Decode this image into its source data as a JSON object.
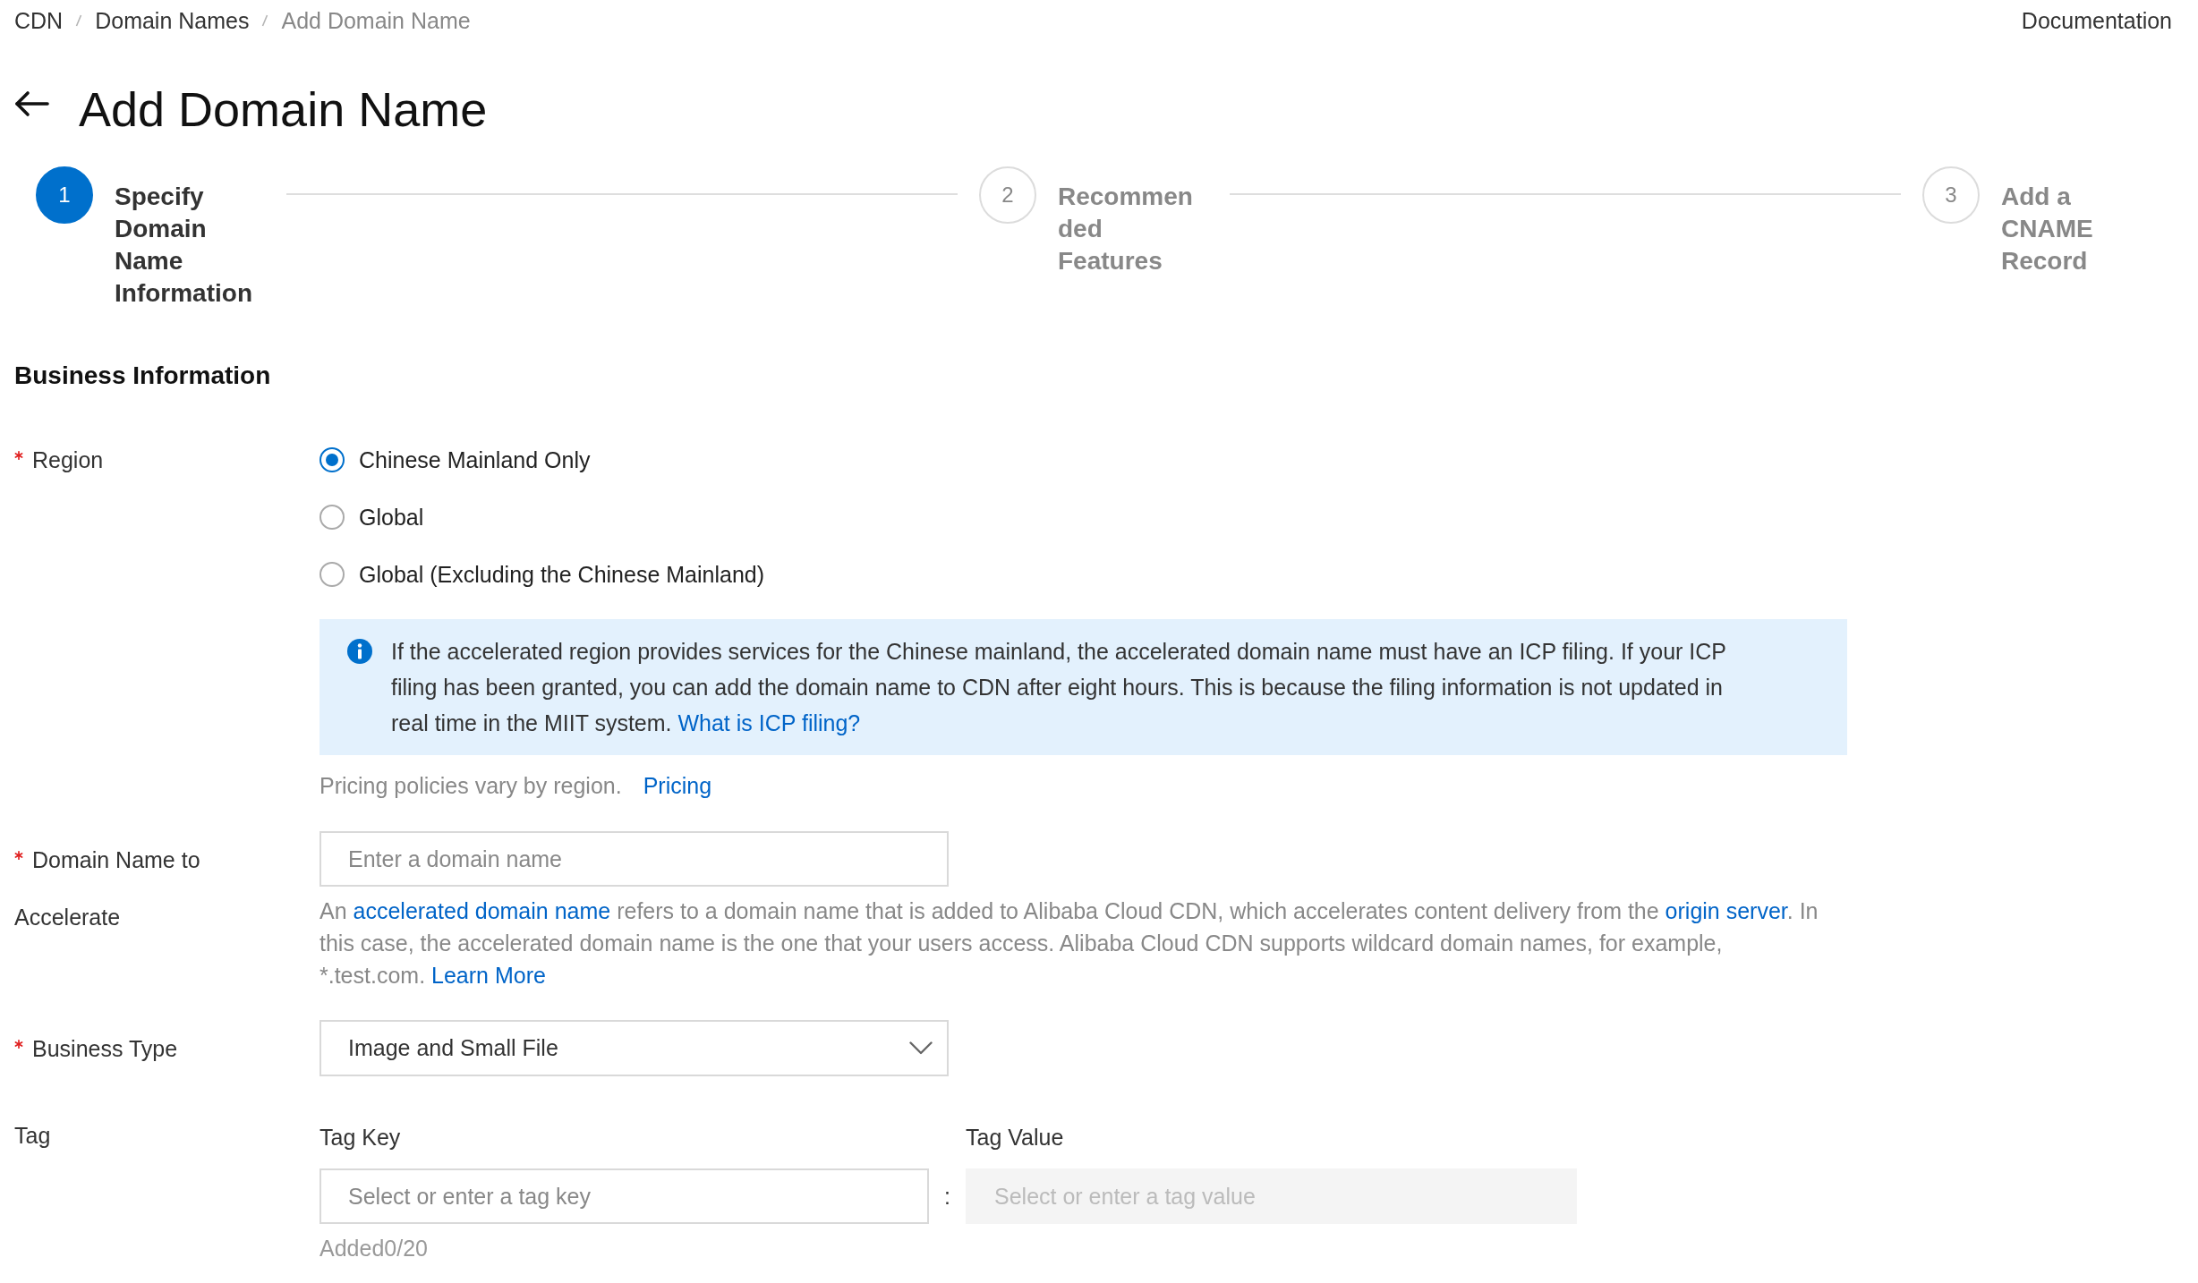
{
  "breadcrumb": [
    {
      "label": "CDN",
      "current": false
    },
    {
      "label": "Domain Names",
      "current": false
    },
    {
      "label": "Add Domain Name",
      "current": true
    }
  ],
  "header_link": "Documentation",
  "page_title": "Add Domain Name",
  "steps": [
    {
      "number": "1",
      "label": "Specify Domain Name Information",
      "current": true
    },
    {
      "number": "2",
      "label": "Recommended Features",
      "current": false
    },
    {
      "number": "3",
      "label": "Add a CNAME Record",
      "current": false
    }
  ],
  "section_title": "Business Information",
  "form": {
    "region": {
      "label": "Region",
      "required": true,
      "options": [
        {
          "label": "Chinese Mainland Only",
          "selected": true
        },
        {
          "label": "Global",
          "selected": false
        },
        {
          "label": "Global (Excluding the Chinese Mainland)",
          "selected": false
        }
      ],
      "notice": [
        {
          "kind": "text",
          "text": "If the accelerated region provides services for the Chinese mainland, the accelerated domain name must have an ICP filing. If your ICP filing has been granted, you can add the domain name to CDN after eight hours. This is because the filing information is not updated in real time in the MIIT system. "
        },
        {
          "kind": "link",
          "text": "What is ICP filing?"
        }
      ],
      "pricing_note": "Pricing policies vary by region.",
      "pricing_link": "Pricing"
    },
    "domain": {
      "label": "Domain Name to Accelerate",
      "required": true,
      "placeholder": "Enter a domain name",
      "help": [
        {
          "kind": "text",
          "text": "An "
        },
        {
          "kind": "link",
          "text": "accelerated domain name"
        },
        {
          "kind": "text",
          "text": " refers to a domain name that is added to Alibaba Cloud CDN, which accelerates content delivery from the "
        },
        {
          "kind": "link",
          "text": "origin server"
        },
        {
          "kind": "text",
          "text": ". In this case, the accelerated domain name is the one that your users access. Alibaba Cloud CDN supports wildcard domain names, for example, *.test.com. "
        },
        {
          "kind": "link",
          "text": "Learn More"
        }
      ]
    },
    "business_type": {
      "label": "Business Type",
      "required": true,
      "value": "Image and Small File"
    },
    "tag": {
      "label": "Tag",
      "required": false,
      "key_label": "Tag Key",
      "value_label": "Tag Value",
      "key_placeholder": "Select or enter a tag key",
      "separator": ":",
      "value_placeholder": "Select or enter a tag value",
      "value_disabled": true,
      "count": "Added0/20"
    }
  }
}
